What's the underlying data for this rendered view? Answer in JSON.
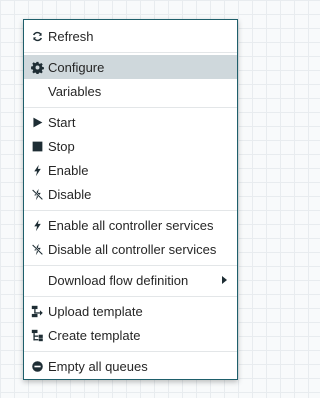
{
  "menu": {
    "refresh": "Refresh",
    "configure": "Configure",
    "variables": "Variables",
    "start": "Start",
    "stop": "Stop",
    "enable": "Enable",
    "disable": "Disable",
    "enable_all": "Enable all controller services",
    "disable_all": "Disable all controller services",
    "download": "Download flow definition",
    "upload": "Upload template",
    "create": "Create template",
    "empty": "Empty all queues"
  },
  "icons": {
    "refresh": "refresh-icon",
    "configure": "gear-icon",
    "start": "play-icon",
    "stop": "stop-icon",
    "enable": "bolt-icon",
    "disable": "bolt-slash-icon",
    "download": "chevron-right-icon",
    "upload": "upload-template-icon",
    "create": "create-template-icon",
    "empty": "minus-circle-icon"
  },
  "colors": {
    "icon": "#1e2d34",
    "selected_bg": "#cfd8dc",
    "border": "#1e5f6b"
  }
}
